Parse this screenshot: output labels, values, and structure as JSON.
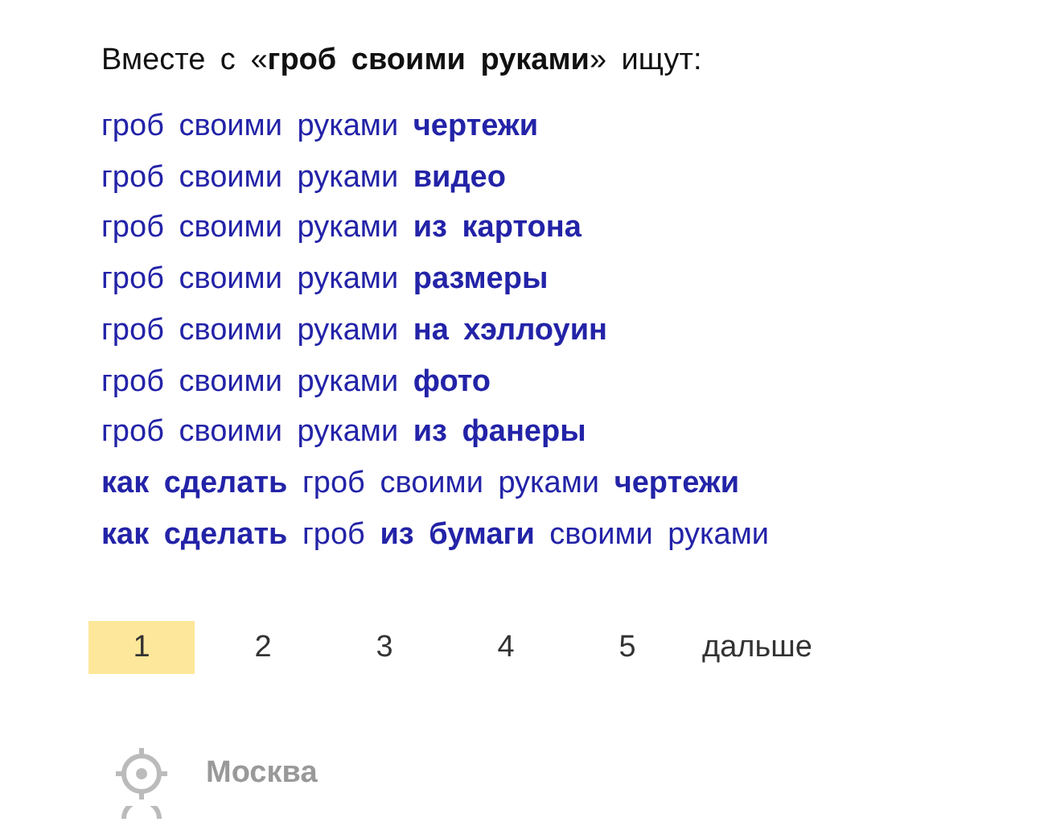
{
  "related": {
    "heading": "Вместе с «**гроб своими руками**» ищут:",
    "suggestions": [
      "гроб своими руками **чертежи**",
      "гроб своими руками **видео**",
      "гроб своими руками **из картона**",
      "гроб своими руками **размеры**",
      "гроб своими руками **на хэллоуин**",
      "гроб своими руками **фото**",
      "гроб своими руками **из фанеры**",
      "**как сделать** гроб своими руками **чертежи**",
      "**как сделать** гроб **из бумаги** своими руками"
    ]
  },
  "pager": {
    "pages": [
      {
        "label": "1",
        "selected": true
      },
      {
        "label": "2",
        "selected": false
      },
      {
        "label": "3",
        "selected": false
      },
      {
        "label": "4",
        "selected": false
      },
      {
        "label": "5",
        "selected": false
      }
    ],
    "next": "дальше"
  },
  "footer": {
    "region": "Москва"
  }
}
